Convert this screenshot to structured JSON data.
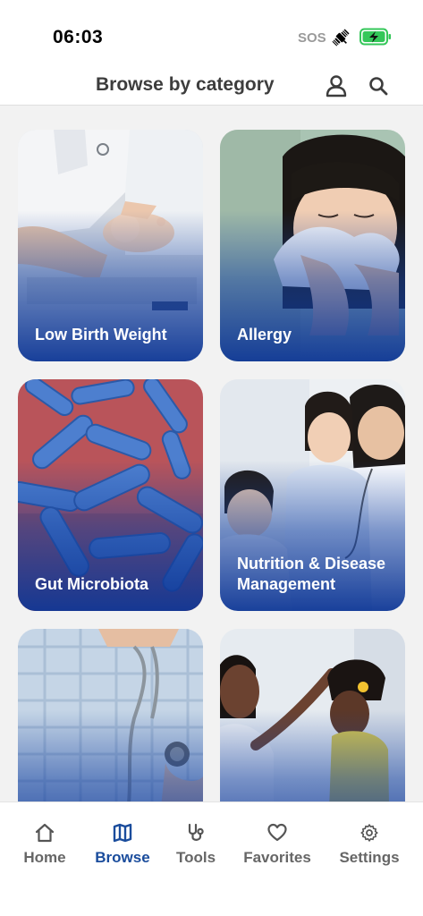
{
  "status_bar": {
    "time": "06:03",
    "sos": "SOS",
    "icons": [
      "satellite-icon",
      "battery-charging-icon"
    ],
    "battery_color": "#34c759"
  },
  "header": {
    "title": "Browse by category",
    "icons": [
      "profile-icon",
      "search-icon"
    ]
  },
  "categories": [
    {
      "label": "Low Birth Weight",
      "image": "newborn-being-weighed-photo"
    },
    {
      "label": "Allergy",
      "image": "child-blowing-nose-photo"
    },
    {
      "label": "Gut Microbiota",
      "image": "bacteria-microscope-photo"
    },
    {
      "label": "Nutrition & Disease Management",
      "image": "doctor-mother-child-photo"
    },
    {
      "label": "",
      "image": "stethoscope-on-child-photo"
    },
    {
      "label": "",
      "image": "mother-braiding-daughter-hair-photo"
    }
  ],
  "tabbar": {
    "active_tab": "Browse",
    "accent_color": "#1a4c9c",
    "tabs": [
      {
        "label": "Home",
        "icon": "home-icon"
      },
      {
        "label": "Browse",
        "icon": "map-icon"
      },
      {
        "label": "Tools",
        "icon": "stethoscope-icon"
      },
      {
        "label": "Favorites",
        "icon": "heart-icon"
      },
      {
        "label": "Settings",
        "icon": "gear-icon"
      }
    ]
  }
}
